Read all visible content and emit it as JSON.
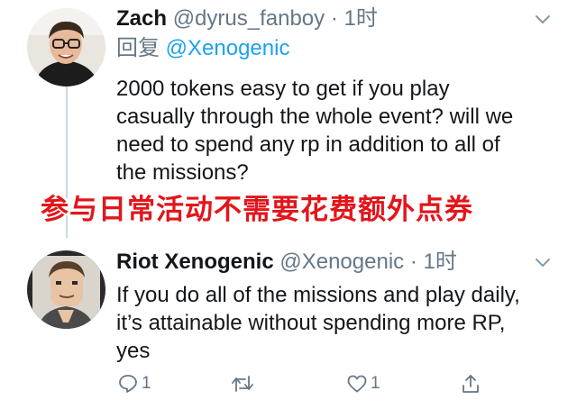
{
  "tweets": [
    {
      "author_name": "Zach",
      "author_handle": "@dyrus_fanboy",
      "separator": "·",
      "timestamp": "1时",
      "reply_prefix": "回复",
      "reply_to": "@Xenogenic",
      "text_lines": [
        "2000 tokens easy to get if you play",
        "casually through the whole event? will we",
        "need to spend any rp in addition to all of",
        "the missions?"
      ],
      "more_icon": "chevron-down-icon"
    },
    {
      "author_name": "Riot Xenogenic",
      "author_handle": "@Xenogenic",
      "separator": "·",
      "timestamp": "1时",
      "text_lines": [
        "If you do all of the missions and play daily,",
        "it’s attainable without spending more RP,",
        "yes"
      ],
      "more_icon": "chevron-down-icon",
      "actions": {
        "reply_count": "1",
        "retweet_count": "",
        "like_count": "1"
      }
    }
  ],
  "overlay_caption": "参与日常活动不需要花费额外点券",
  "colors": {
    "text": "#14171a",
    "secondary": "#657786",
    "link": "#1da1f2",
    "caption": "#e3151b",
    "thread_line": "#ccd6dd"
  }
}
